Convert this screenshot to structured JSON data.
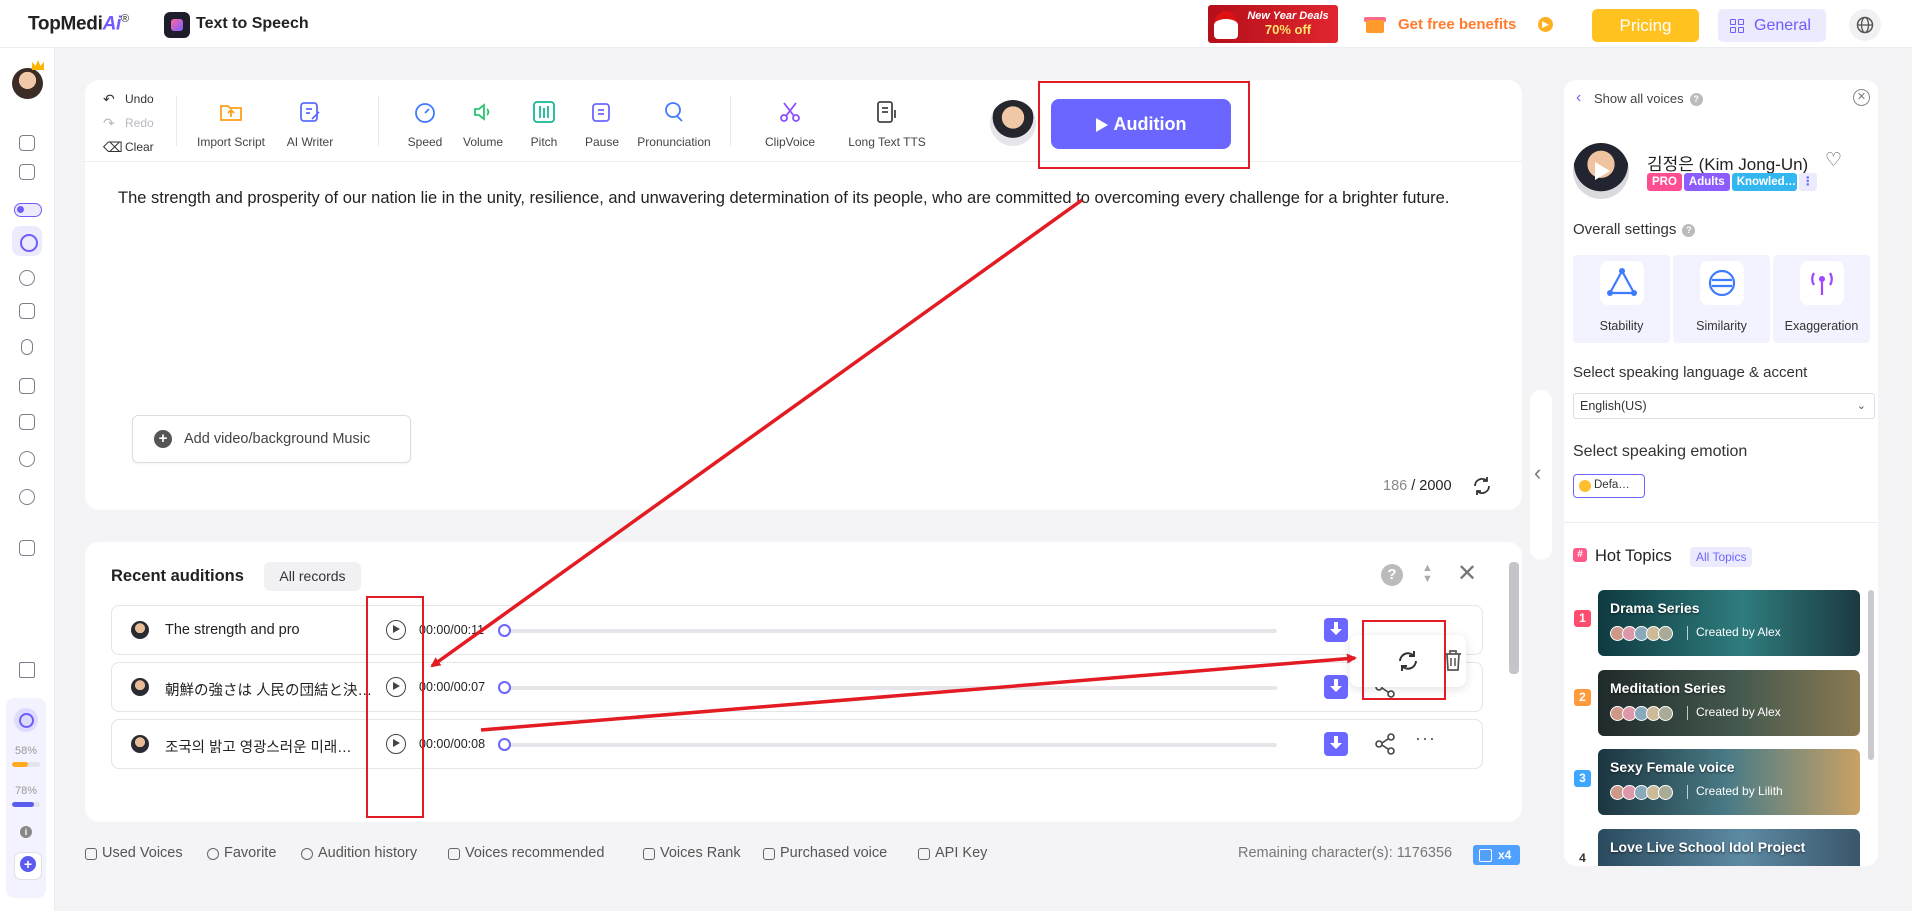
{
  "header": {
    "brand": "TopMediAi",
    "brand_accent": "Ai",
    "brand_prefix": "TopMedi",
    "brand_reg": "®",
    "product_title": "Text to Speech",
    "promo_line1": "New Year Deals",
    "promo_line2": "70% off",
    "benefits_label": "Get free benefits",
    "pricing_label": "Pricing",
    "general_label": "General"
  },
  "sidebar": {
    "quota1_pct": "58%",
    "quota1_value": 0.58,
    "quota2_pct": "78%",
    "quota2_value": 0.78
  },
  "toolbar": {
    "undo": "Undo",
    "redo": "Redo",
    "clear": "Clear",
    "import_script": "Import Script",
    "ai_writer": "AI Writer",
    "speed": "Speed",
    "volume": "Volume",
    "pitch": "Pitch",
    "pause": "Pause",
    "pronunciation": "Pronunciation",
    "clipvoice": "ClipVoice",
    "long_text": "Long Text TTS",
    "audition": "Audition"
  },
  "editor": {
    "text": "The strength and prosperity of our nation lie in the unity, resilience, and unwavering determination of its people, who are committed to overcoming every challenge for a brighter future.",
    "add_music": "Add video/background Music",
    "char_used": "186",
    "char_sep": " / ",
    "char_max": "2000"
  },
  "recent": {
    "title": "Recent auditions",
    "all_records": "All records",
    "rows": [
      {
        "text": "The strength and pro",
        "time": "00:00/00:11"
      },
      {
        "text": "朝鮮の強さは 人民の団結と決…",
        "time": "00:00/00:07"
      },
      {
        "text": "조국의 밝고 영광스러운 미래…",
        "time": "00:00/00:08"
      }
    ]
  },
  "bottom_nav": {
    "used_voices": "Used Voices",
    "favorite": "Favorite",
    "history": "Audition history",
    "recommended": "Voices recommended",
    "rank": "Voices Rank",
    "purchased": "Purchased voice",
    "api_key": "API Key",
    "remaining": "Remaining character(s): 1176356",
    "multiplier": "x4"
  },
  "right_panel": {
    "show_all": "Show all voices",
    "voice_name": "김정은 (Kim Jong-Un)",
    "tags": [
      {
        "label": "PRO",
        "color": "#ff4d94"
      },
      {
        "label": "Adults",
        "color": "#8c5cff"
      },
      {
        "label": "Knowled…",
        "color": "#34b7f1"
      }
    ],
    "overall_settings": "Overall settings",
    "settings": [
      "Stability",
      "Similarity",
      "Exaggeration"
    ],
    "language_label": "Select speaking language & accent",
    "language_value": "English(US)",
    "emotion_label": "Select speaking emotion",
    "emotion_value": "Defa…",
    "hot_topics": "Hot Topics",
    "all_topics": "All Topics",
    "topics": [
      {
        "rank": "1",
        "name": "Drama Series",
        "creator": "Created by Alex",
        "rank_color": "#ff4d6d"
      },
      {
        "rank": "2",
        "name": "Meditation Series",
        "creator": "Created by Alex",
        "rank_color": "#ff9b3d"
      },
      {
        "rank": "3",
        "name": "Sexy Female voice",
        "creator": "Created by Lilith",
        "rank_color": "#3ea6ff"
      },
      {
        "rank": "4",
        "name": "Love Live School Idol Project",
        "creator": "",
        "rank_color": ""
      }
    ]
  },
  "colors": {
    "accent": "#6b66ff",
    "pricing": "#ffc21f",
    "annotation": "#e31b23"
  }
}
